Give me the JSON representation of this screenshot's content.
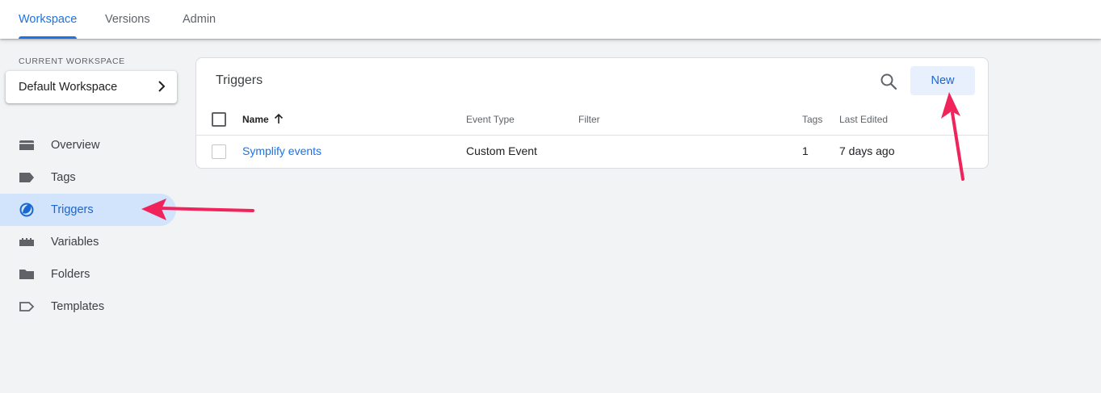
{
  "tabs": [
    {
      "label": "Workspace",
      "active": true
    },
    {
      "label": "Versions",
      "active": false
    },
    {
      "label": "Admin",
      "active": false
    }
  ],
  "sidebar": {
    "current_workspace_label": "CURRENT WORKSPACE",
    "workspace_name": "Default Workspace",
    "items": [
      {
        "label": "Overview",
        "icon": "overview-icon"
      },
      {
        "label": "Tags",
        "icon": "tag-icon"
      },
      {
        "label": "Triggers",
        "icon": "trigger-icon",
        "active": true
      },
      {
        "label": "Variables",
        "icon": "variables-icon"
      },
      {
        "label": "Folders",
        "icon": "folder-icon"
      },
      {
        "label": "Templates",
        "icon": "template-icon"
      }
    ]
  },
  "triggers": {
    "title": "Triggers",
    "new_label": "New",
    "columns": {
      "name": "Name",
      "event_type": "Event Type",
      "filter": "Filter",
      "tags": "Tags",
      "last_edited": "Last Edited"
    },
    "rows": [
      {
        "name": "Symplify events",
        "event_type": "Custom Event",
        "filter": "",
        "tags": "1",
        "last_edited": "7 days ago"
      }
    ]
  },
  "colors": {
    "accent": "#1a73e8",
    "active_nav_bg": "#d2e3fc",
    "annotation_arrow": "#f0245a"
  }
}
